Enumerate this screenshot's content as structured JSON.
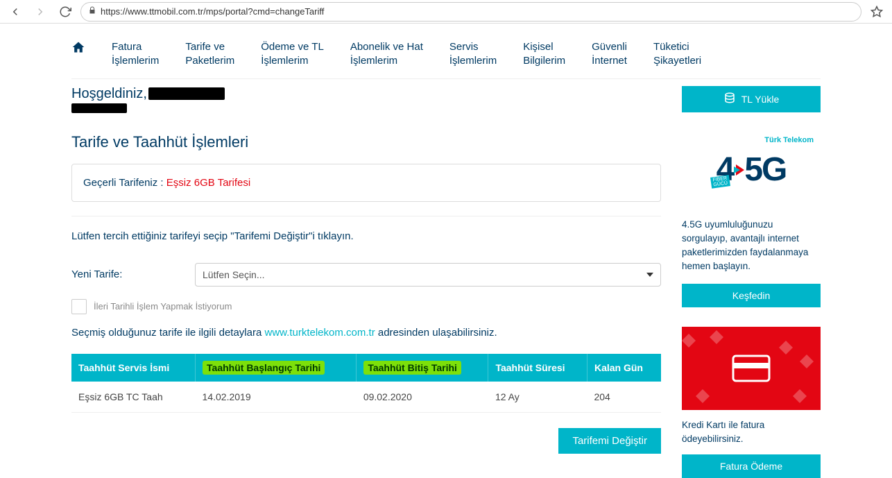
{
  "browser": {
    "url": "https://www.ttmobil.com.tr/mps/portal?cmd=changeTariff"
  },
  "nav": {
    "items": [
      "Fatura\nİşlemlerim",
      "Tarife ve\nPaketlerim",
      "Ödeme ve TL\nİşlemlerim",
      "Abonelik ve Hat\nİşlemlerim",
      "Servis\nİşlemlerim",
      "Kişisel\nBilgilerim",
      "Güvenli\nİnternet",
      "Tüketici\nŞikayetleri"
    ]
  },
  "welcome": "Hoşgeldiniz,",
  "page_title": "Tarife ve Taahhüt İşlemleri",
  "current_tariff": {
    "label": "Geçerli Tarifeniz :",
    "name": "Eşsiz 6GB Tarifesi"
  },
  "instruction": "Lütfen tercih ettiğiniz tarifeyi seçip \"Tarifemi Değiştir\"i tıklayın.",
  "new_tariff": {
    "label": "Yeni Tarife:",
    "placeholder": "Lütfen Seçin..."
  },
  "future_date_checkbox": "İleri Tarihli İşlem Yapmak İstiyorum",
  "details": {
    "before": "Seçmiş olduğunuz tarife ile ilgili detaylara ",
    "link": "www.turktelekom.com.tr",
    "after": " adresinden ulaşabilirsiniz."
  },
  "table": {
    "headers": {
      "service": "Taahhüt Servis İsmi",
      "start": "Taahhüt Başlangıç Tarihi",
      "end": "Taahhüt Bitiş Tarihi",
      "duration": "Taahhüt Süresi",
      "remaining": "Kalan Gün"
    },
    "row": {
      "service": "Eşsiz 6GB TC Taah",
      "start": "14.02.2019",
      "end": "09.02.2020",
      "duration": "12 Ay",
      "remaining": "204"
    }
  },
  "submit_button": "Tarifemi Değiştir",
  "sidebar": {
    "tl_button": "TL Yükle",
    "promo1": {
      "brand": "Türk Telekom",
      "fiber": "FİBER\nGÜCÜ",
      "text": "4.5G uyumluluğunuzu sorgulayıp, avantajlı internet paketlerimizden faydalanmaya hemen başlayın.",
      "button": "Keşfedin"
    },
    "promo2": {
      "text": "Kredi Kartı ile fatura ödeyebilirsiniz.",
      "button": "Fatura Ödeme"
    }
  }
}
